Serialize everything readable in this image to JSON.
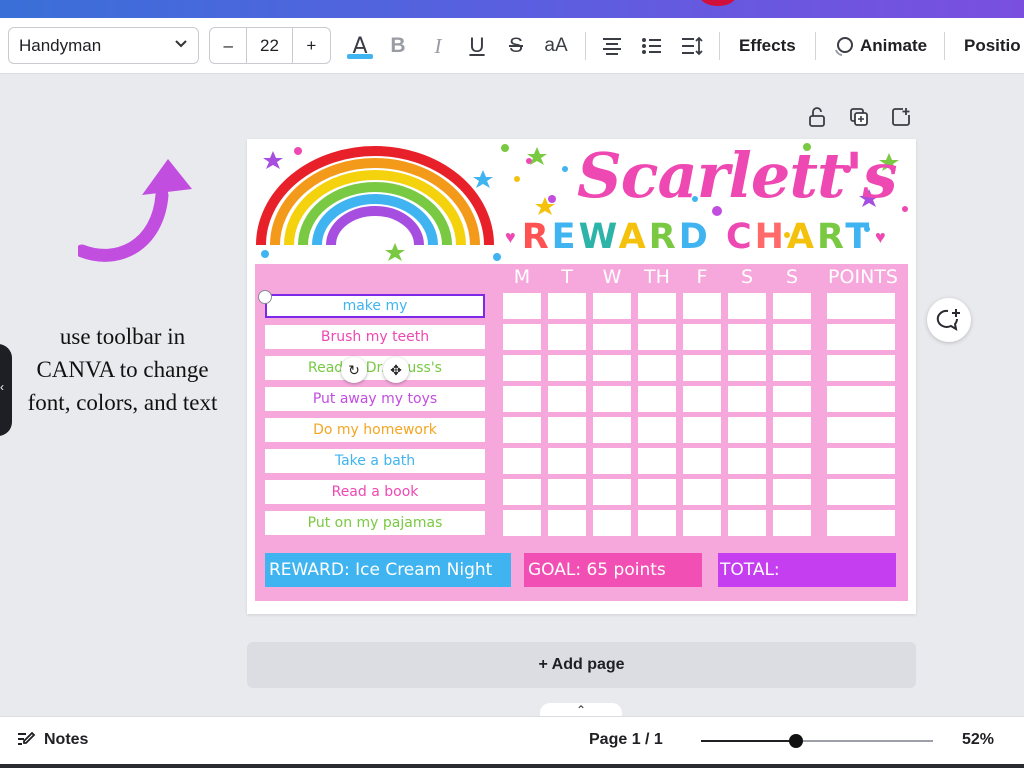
{
  "toolbar": {
    "font_name": "Handyman",
    "font_size": "22",
    "minus": "–",
    "plus": "+",
    "text_color": "#3fb4f0",
    "effects_label": "Effects",
    "animate_label": "Animate",
    "position_label": "Positio"
  },
  "instructions": "use toolbar in CANVA to change font, colors, and text",
  "chart": {
    "title": "Scarlett's",
    "subtitle_parts": [
      {
        "text": "R",
        "color": "#ff5252"
      },
      {
        "text": "E",
        "color": "#3fb4f0"
      },
      {
        "text": "W",
        "color": "#2db4a8"
      },
      {
        "text": "A",
        "color": "#f4c20d"
      },
      {
        "text": "R",
        "color": "#7ac943"
      },
      {
        "text": "D",
        "color": "#3fb4f0"
      },
      {
        "text": " ",
        "color": "#ffffff"
      },
      {
        "text": "C",
        "color": "#ee49b2"
      },
      {
        "text": "H",
        "color": "#ff6b6b"
      },
      {
        "text": "A",
        "color": "#f4c20d"
      },
      {
        "text": "R",
        "color": "#7ac943"
      },
      {
        "text": "T",
        "color": "#3fb4f0"
      }
    ],
    "days": [
      "M",
      "T",
      "W",
      "TH",
      "F",
      "S",
      "S"
    ],
    "points_header": "POINTS",
    "tasks": [
      {
        "label": "make my",
        "color": "#3fb4f0"
      },
      {
        "label": "Brush my teeth",
        "color": "#ee49b2"
      },
      {
        "label": "Read m  Dr. Seuss's",
        "color": "#7ac943"
      },
      {
        "label": "Put away my toys",
        "color": "#c24ee0"
      },
      {
        "label": "Do my homework",
        "color": "#f4a623"
      },
      {
        "label": "Take a bath",
        "color": "#3fb4f0"
      },
      {
        "label": "Read a book",
        "color": "#ee49b2"
      },
      {
        "label": "Put on my pajamas",
        "color": "#7ac943"
      }
    ],
    "reward": "REWARD: Ice Cream Night",
    "goal": "GOAL: 65 points",
    "total": "TOTAL:",
    "reward_color": "#3fb4f0",
    "goal_color": "#f24fb4",
    "total_color": "#c53ff0"
  },
  "add_page_label": "+ Add page",
  "bottom": {
    "notes_label": "Notes",
    "page_indicator": "Page 1 / 1",
    "zoom_label": "52%",
    "zoom_fraction": 0.41
  },
  "icons": {
    "bold": "B",
    "italic": "I",
    "underline": "U",
    "strike": "S",
    "case": "aA"
  }
}
